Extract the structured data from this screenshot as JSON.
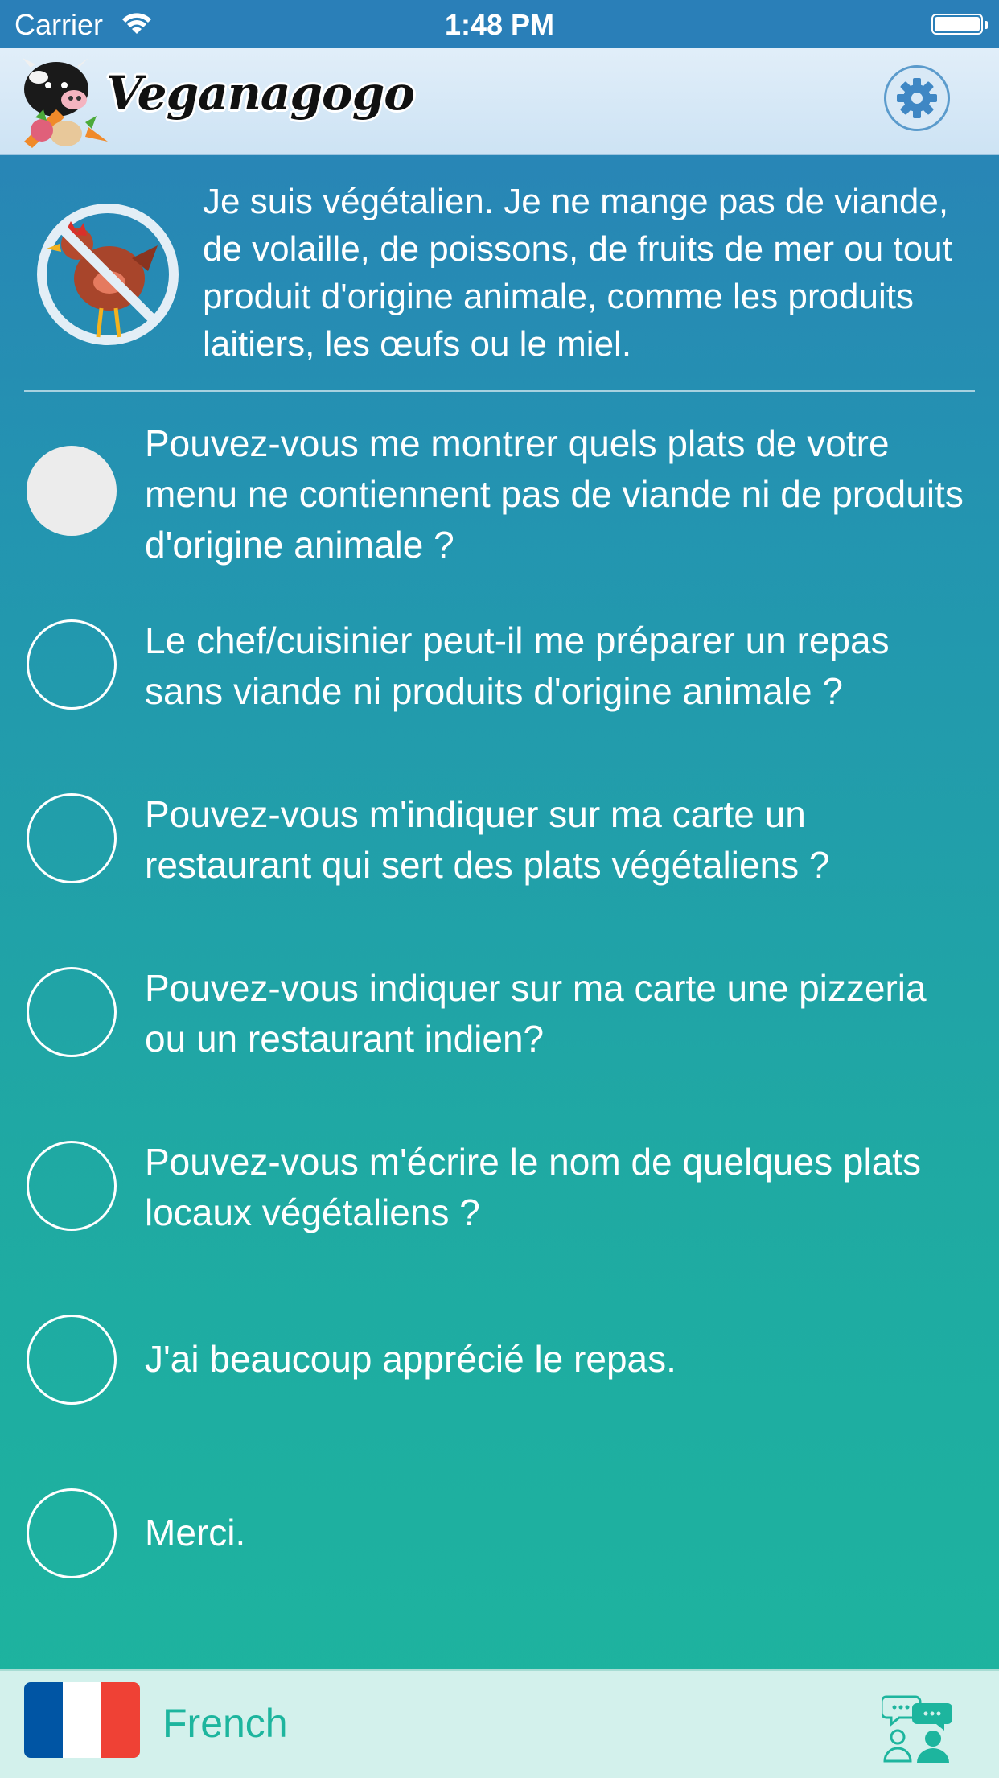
{
  "status_bar": {
    "carrier": "Carrier",
    "time": "1:48 PM",
    "battery_level": 1.0
  },
  "nav_bar": {
    "app_name": "Veganagogo",
    "settings_icon": "gear-icon"
  },
  "intro": {
    "icon": "no-animal-icon",
    "text": "Je suis végétalien. Je ne mange pas de viande, de volaille, de poissons, de fruits de mer ou tout produit d'origine animale, comme les produits laitiers, les œufs ou le miel."
  },
  "phrases": [
    {
      "text": "Pouvez-vous me montrer quels plats de votre menu ne contiennent pas de viande ni de produits d'origine animale ?",
      "selected": true
    },
    {
      "text": "Le chef/cuisinier peut-il me préparer un repas sans viande ni produits d'origine animale ?",
      "selected": false
    },
    {
      "text": "Pouvez-vous m'indiquer sur ma carte un restaurant qui sert des plats végétaliens ?",
      "selected": false
    },
    {
      "text": "Pouvez-vous indiquer sur ma carte une pizzeria ou un restaurant indien?",
      "selected": false
    },
    {
      "text": "Pouvez-vous m'écrire le nom de quelques plats locaux végétaliens ?",
      "selected": false
    },
    {
      "text": "J'ai beaucoup apprécié le repas.",
      "selected": false
    },
    {
      "text": "Merci.",
      "selected": false
    }
  ],
  "bottom_bar": {
    "language": "French",
    "flag_colors": [
      "#0055a4",
      "#ffffff",
      "#ef4135"
    ],
    "chat_icon": "conversation-icon"
  },
  "colors": {
    "accent": "#1db59e",
    "nav_blue": "#2a7fb8"
  }
}
